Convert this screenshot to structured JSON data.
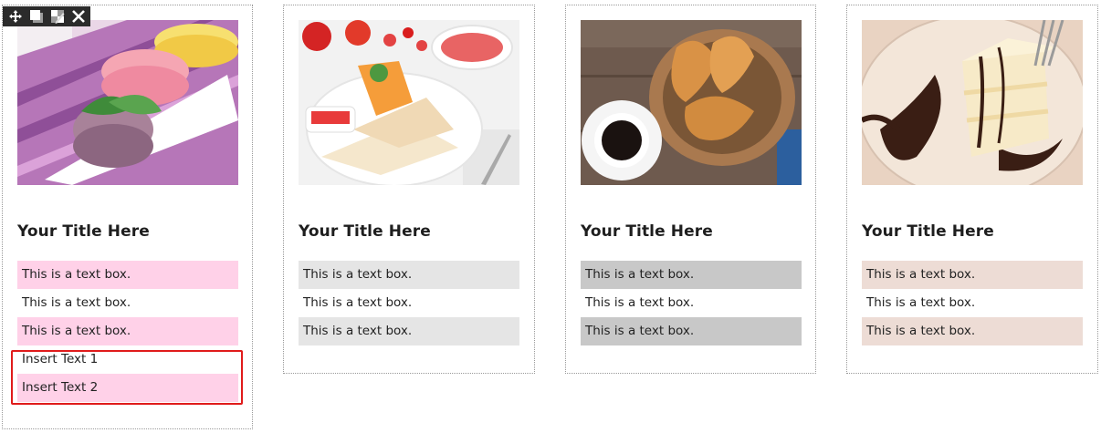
{
  "toolbar": {
    "icons": [
      "move-icon",
      "duplicate-icon",
      "edit-style-icon",
      "close-icon"
    ]
  },
  "cards": [
    {
      "image": "macarons-photo",
      "title": "Your Title Here",
      "accent": "#ffd1e8",
      "boxes": [
        "This is a text box.",
        "This is a text box.",
        "This is a text box.",
        "Insert Text 1",
        "Insert Text 2"
      ]
    },
    {
      "image": "quesadilla-photo",
      "title": "Your Title Here",
      "accent": "#e5e5e5",
      "boxes": [
        "This is a text box.",
        "This is a text box.",
        "This is a text box."
      ]
    },
    {
      "image": "croissants-coffee-photo",
      "title": "Your Title Here",
      "accent": "#c8c8c8",
      "boxes": [
        "This is a text box.",
        "This is a text box.",
        "This is a text box."
      ]
    },
    {
      "image": "cake-chocolate-photo",
      "title": "Your Title Here",
      "accent": "#eddcd5",
      "boxes": [
        "This is a text box.",
        "This is a text box.",
        "This is a text box."
      ]
    }
  ],
  "selection_color": "#e01b1b"
}
